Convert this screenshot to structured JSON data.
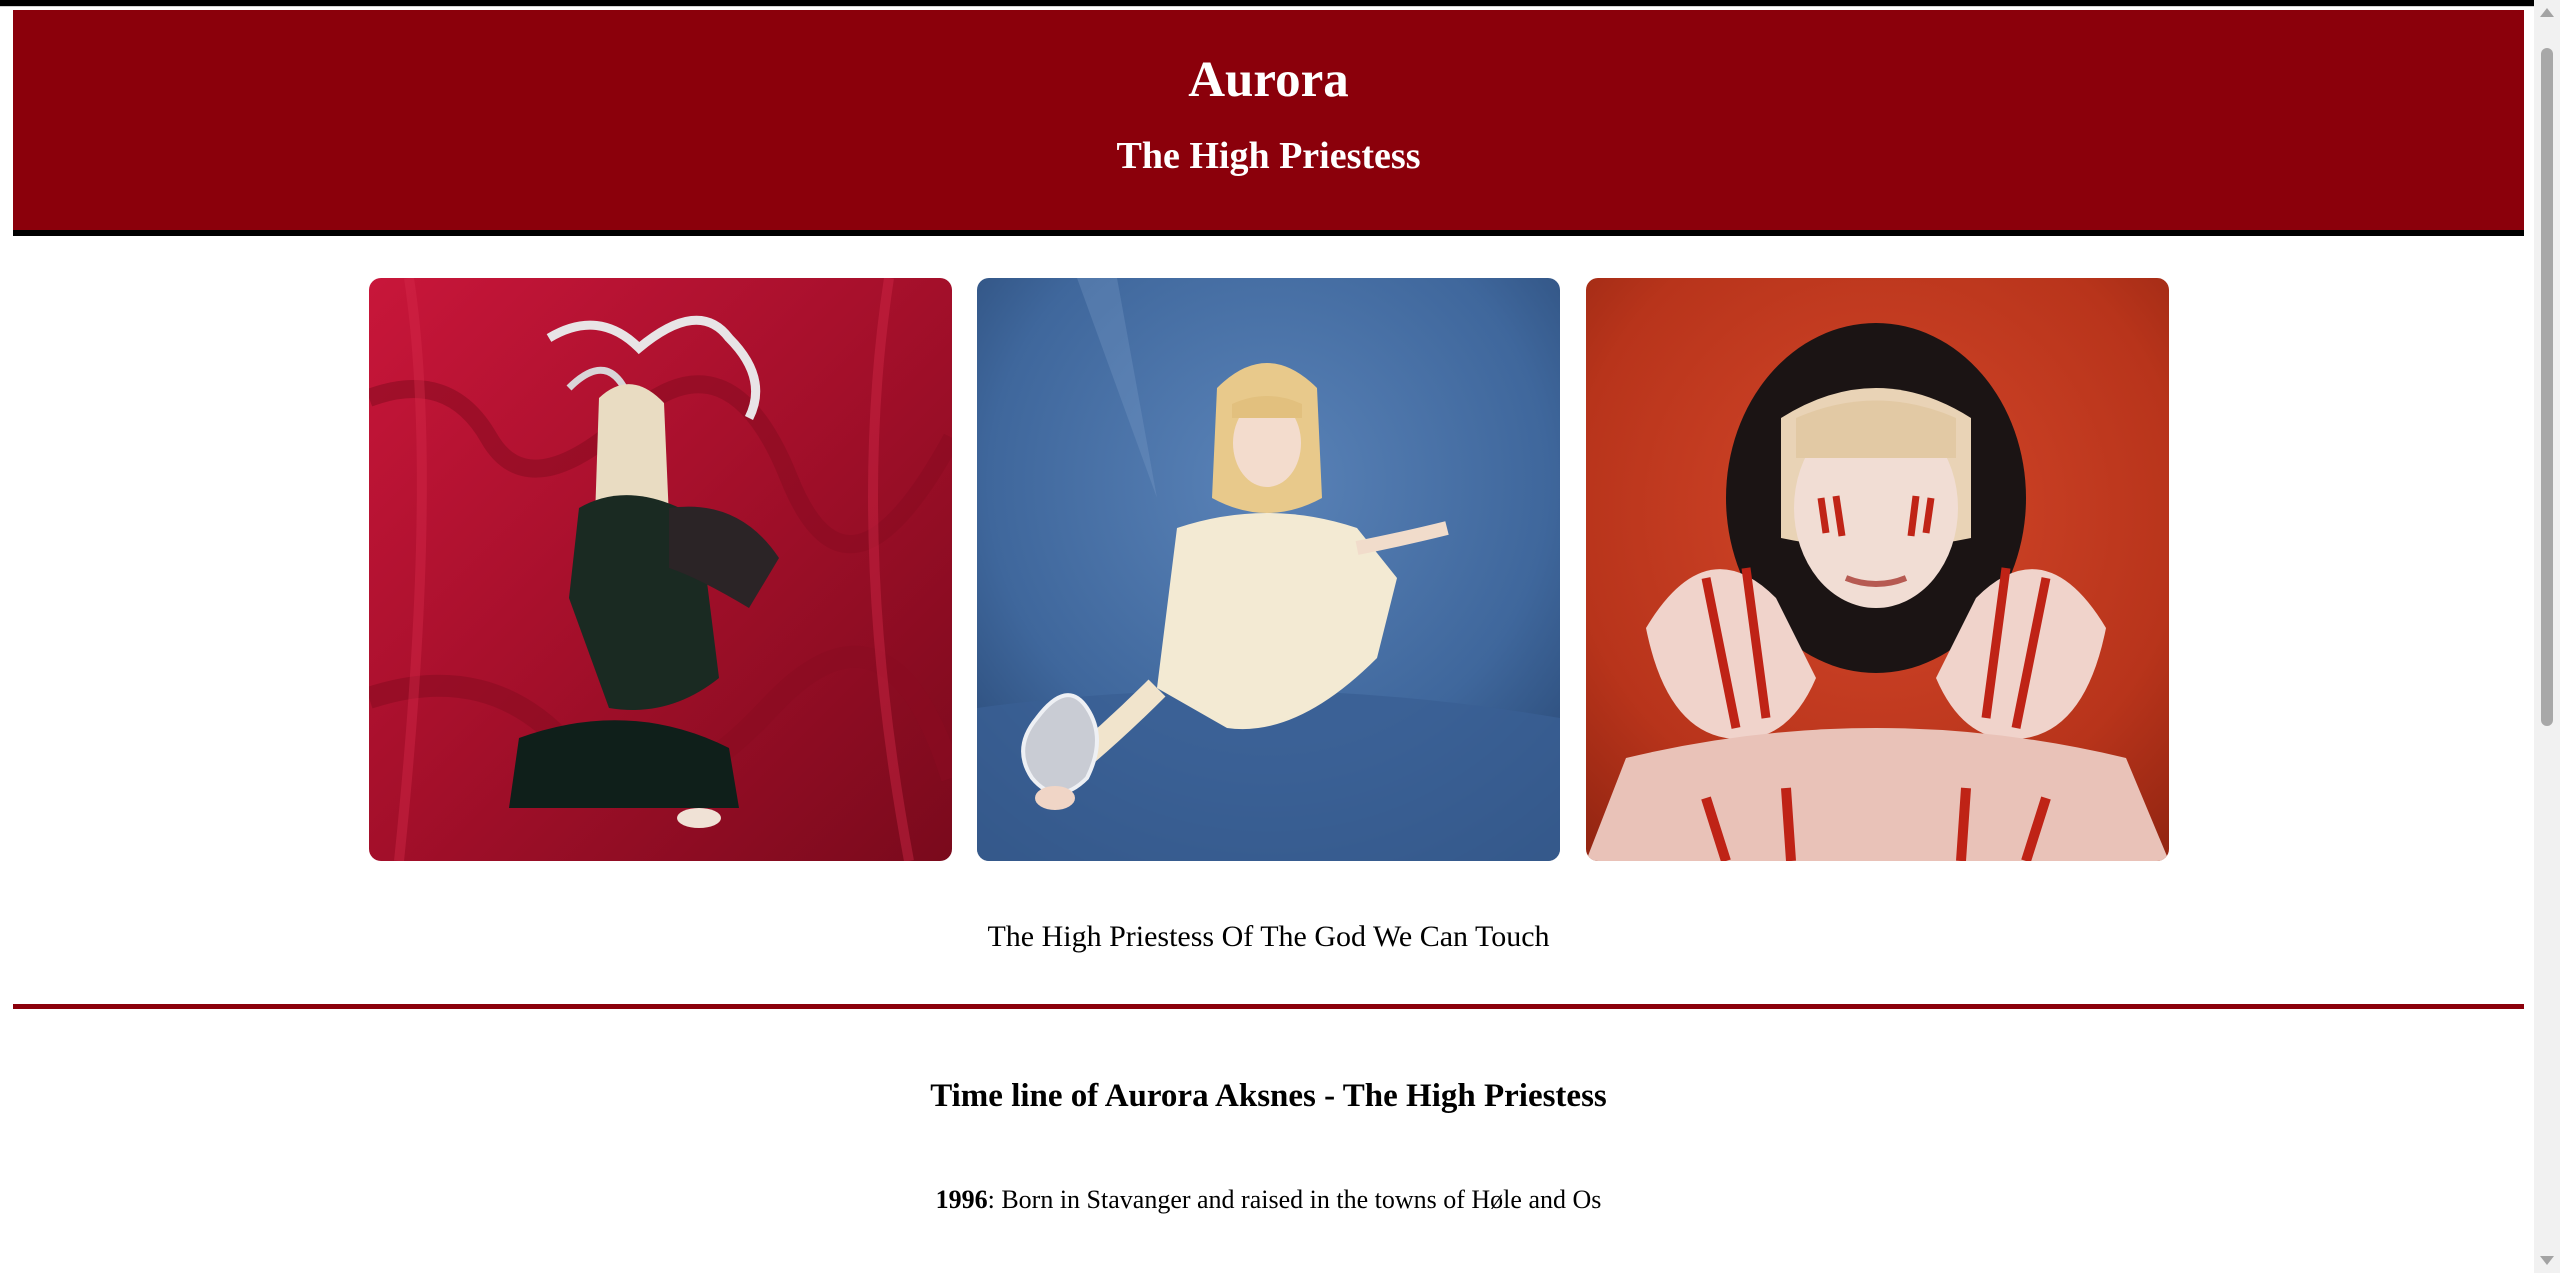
{
  "header": {
    "title": "Aurora",
    "subtitle": "The High Priestess"
  },
  "gallery": {
    "caption": "The High Priestess Of The God We Can Touch",
    "images": [
      {
        "icon": "photo-red-drapery-portrait",
        "accent": "#b01428"
      },
      {
        "icon": "photo-blue-backdrop-silver-heart",
        "accent": "#3d6aa3"
      },
      {
        "icon": "photo-orange-face-paint-portrait",
        "accent": "#c23b1f"
      }
    ]
  },
  "timeline": {
    "title": "Time line of Aurora Aksnes - The High Priestess",
    "entries": [
      {
        "year": "1996",
        "text": ": Born in Stavanger and raised in the towns of Høle and Os"
      }
    ]
  },
  "colors": {
    "brand": "#8b000b",
    "header_border": "#000000"
  }
}
